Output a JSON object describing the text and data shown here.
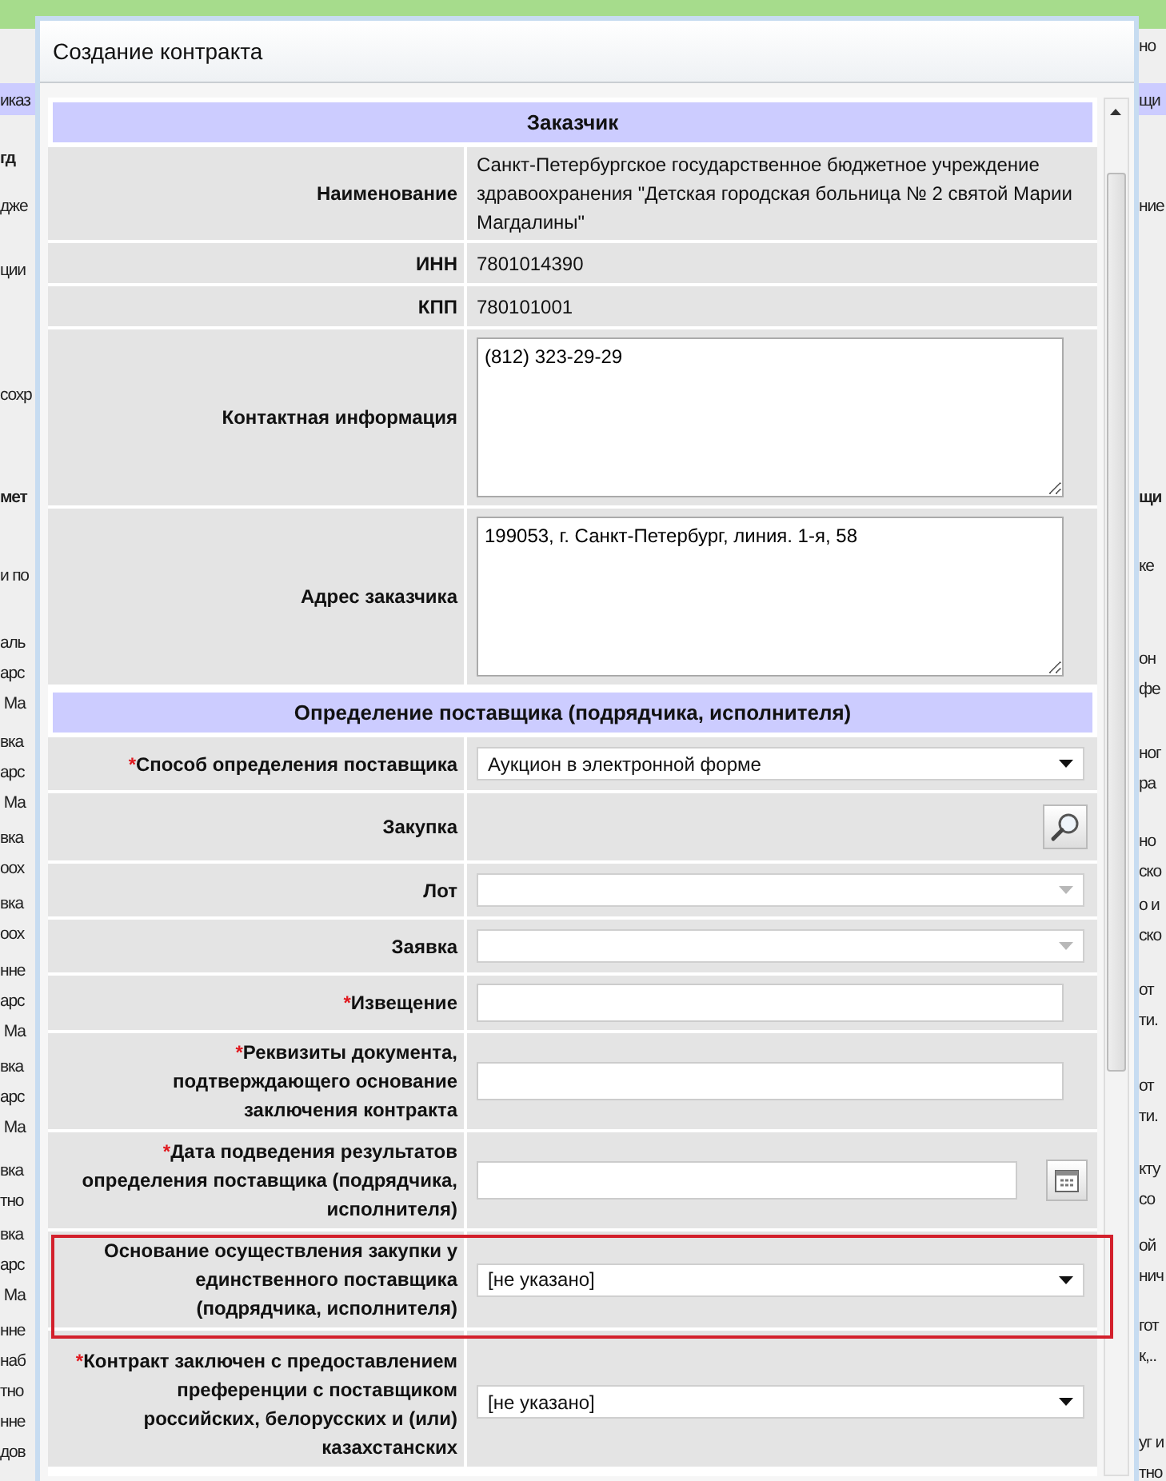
{
  "background": {
    "left_fragments": [
      {
        "lines": [
          "иказ"
        ],
        "bold": false
      },
      {
        "lines": [
          "гд"
        ],
        "bold": true
      },
      {
        "lines": [
          "дже"
        ],
        "bold": false
      },
      {
        "lines": [
          "ции"
        ],
        "bold": false
      },
      {
        "lines": [
          "сохр"
        ],
        "bold": false
      },
      {
        "lines": [
          "мет"
        ],
        "bold": true
      },
      {
        "lines": [
          "и по"
        ],
        "bold": false
      },
      {
        "lines": [
          "аль",
          "арс",
          " Ма"
        ],
        "bold": false
      },
      {
        "lines": [
          "вка",
          "арс",
          " Ма"
        ],
        "bold": false
      },
      {
        "lines": [
          "вка",
          "оох"
        ],
        "bold": false
      },
      {
        "lines": [
          "вка",
          "оох"
        ],
        "bold": false
      },
      {
        "lines": [
          "нне",
          "арс",
          " Ма"
        ],
        "bold": false
      },
      {
        "lines": [
          "вка",
          "арс",
          " Ма"
        ],
        "bold": false
      },
      {
        "lines": [
          "вка",
          "тно"
        ],
        "bold": false
      },
      {
        "lines": [
          "вка",
          "арс",
          " Ма"
        ],
        "bold": false
      },
      {
        "lines": [
          "нне",
          "наб",
          "тно"
        ],
        "bold": false
      },
      {
        "lines": [
          "нне",
          "дов"
        ],
        "bold": false
      }
    ],
    "right_fragments": [
      {
        "lines": [
          "но"
        ],
        "bold": false
      },
      {
        "lines": [
          "щи"
        ],
        "bold": false
      },
      {
        "lines": [
          "ние"
        ],
        "bold": false
      },
      {
        "lines": [
          "щи"
        ],
        "bold": true
      },
      {
        "lines": [
          "ке"
        ],
        "bold": false
      },
      {
        "lines": [
          "он",
          "фе"
        ],
        "bold": false
      },
      {
        "lines": [
          "ног",
          "ра"
        ],
        "bold": false
      },
      {
        "lines": [
          "но",
          "ско"
        ],
        "bold": false
      },
      {
        "lines": [
          "о и",
          "ско"
        ],
        "bold": false
      },
      {
        "lines": [
          "от",
          "ти."
        ],
        "bold": false
      },
      {
        "lines": [
          "от",
          "ти."
        ],
        "bold": false
      },
      {
        "lines": [
          "кту",
          "со"
        ],
        "bold": false
      },
      {
        "lines": [
          "ой",
          "нич"
        ],
        "bold": false
      },
      {
        "lines": [
          "гот",
          "к,.."
        ],
        "bold": false
      },
      {
        "lines": [
          "уг и",
          "тно"
        ],
        "bold": false
      }
    ]
  },
  "window": {
    "title": "Создание контракта"
  },
  "sections": [
    {
      "title": "Заказчик",
      "fields": [
        {
          "kind": "text",
          "label": "Наименование",
          "value": "Санкт-Петербургское государственное бюджетное учреждение здравоохранения \"Детская городская больница № 2 святой Марии Магдалины\"",
          "highlighted": false
        },
        {
          "kind": "text",
          "label": "ИНН",
          "value": "7801014390",
          "highlighted": false
        },
        {
          "kind": "text",
          "label": "КПП",
          "value": "780101001",
          "highlighted": false
        },
        {
          "kind": "textarea",
          "label": "Контактная информация",
          "value": "(812) 323-29-29",
          "highlighted": false
        },
        {
          "kind": "textarea",
          "label": "Адрес заказчика",
          "value": "199053, г. Санкт-Петербург, линия. 1-я, 58",
          "highlighted": false
        }
      ]
    },
    {
      "title": "Определение поставщика (подрядчика, исполнителя)",
      "fields": [
        {
          "kind": "select",
          "required_mark": "*",
          "label": "Способ определения поставщика",
          "value": "Аукцион в электронной форме",
          "disabled": false,
          "highlighted": false
        },
        {
          "kind": "lookup",
          "label": "Закупка",
          "highlighted": false
        },
        {
          "kind": "select",
          "label": "Лот",
          "disabled": true,
          "highlighted": false
        },
        {
          "kind": "select",
          "label": "Заявка",
          "disabled": true,
          "highlighted": false
        },
        {
          "kind": "input",
          "required_mark": "*",
          "label": "Извещение",
          "highlighted": false
        },
        {
          "kind": "input",
          "required_mark": "*",
          "label": "Реквизиты документа, подтверждающего основание заключения контракта",
          "highlighted": false
        },
        {
          "kind": "date",
          "required_mark": "*",
          "label": "Дата подведения результатов определения поставщика (подрядчика, исполнителя)",
          "highlighted": false
        },
        {
          "kind": "select",
          "label": "Основание осуществления закупки у единственного поставщика (подрядчика, исполнителя)",
          "value": "[не указано]",
          "disabled": false,
          "highlighted": true
        },
        {
          "kind": "select",
          "required_mark": "*",
          "label": "Контракт заключен с предоставлением преференции с поставщиком российских, белорусских и (или) казахстанских",
          "value": "[не указано]",
          "disabled": false,
          "highlighted": false
        }
      ]
    }
  ]
}
